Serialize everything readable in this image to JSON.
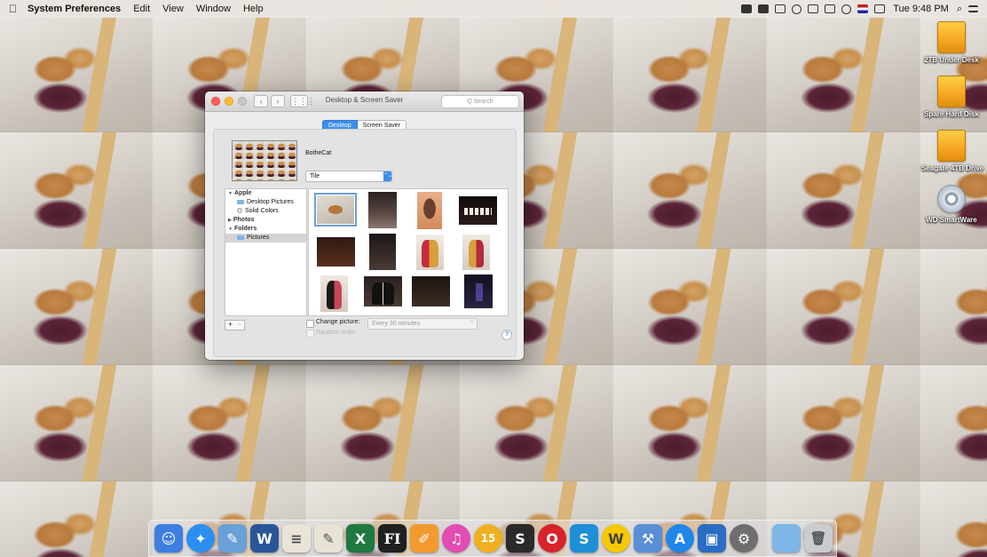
{
  "menubar": {
    "apple": "",
    "app_name": "System Preferences",
    "items": [
      "Edit",
      "View",
      "Window",
      "Help"
    ],
    "clock": "Tue 9:48 PM",
    "search_glyph": "⌕",
    "status_icons": [
      "dropbox-icon",
      "camera-icon",
      "airplay-icon",
      "time-machine-icon",
      "bluetooth-icon",
      "volume-icon",
      "wifi-icon",
      "flag-icon",
      "eject-icon",
      "spotlight-icon",
      "notification-center-icon"
    ]
  },
  "desktop": {
    "drives": [
      {
        "label": "2TB Under Desk",
        "icon": "external-drive-icon"
      },
      {
        "label": "Spare Hard Disk",
        "icon": "external-drive-icon"
      },
      {
        "label": "Seagate 4TB Drive",
        "icon": "external-drive-icon"
      },
      {
        "label": "WD SmartWare",
        "icon": "disc-icon"
      }
    ]
  },
  "window": {
    "title": "Desktop & Screen Saver",
    "search_placeholder": "Q Search",
    "nav_back": "‹",
    "nav_forward": "›",
    "grid_glyph": "⋮⋮⋮",
    "tabs": [
      "Desktop",
      "Screen Saver"
    ],
    "wallpaper_name": "BotheCat",
    "fit_option": "Tile",
    "select_arrow": "⌃⌄",
    "sources": [
      {
        "label": "Apple",
        "type": "group",
        "expand": "▼"
      },
      {
        "label": "Desktop Pictures",
        "type": "child"
      },
      {
        "label": "Solid Colors",
        "type": "child"
      },
      {
        "label": "Photos",
        "type": "group",
        "expand": "▶"
      },
      {
        "label": "Folders",
        "type": "group",
        "expand": "▼"
      },
      {
        "label": "Pictures",
        "type": "child",
        "selected": true
      }
    ],
    "add_label": "+",
    "remove_label": "−",
    "change_picture_label": "Change picture:",
    "interval_value": "Every 30 minutes",
    "interval_arrow": "⌃",
    "random_order_label": "Random order",
    "help_label": "?"
  },
  "dock": {
    "apps": [
      {
        "name": "finder",
        "glyph": "☺",
        "color": "#3d7fe0"
      },
      {
        "name": "safari",
        "glyph": "✦",
        "color": "#2a8ff0"
      },
      {
        "name": "preview",
        "glyph": "✎",
        "color": "#6aa0d8"
      },
      {
        "name": "word",
        "glyph": "W",
        "color": "#2a5699"
      },
      {
        "name": "notes",
        "glyph": "≡",
        "color": "#e9e4d6"
      },
      {
        "name": "textedit",
        "glyph": "✎",
        "color": "#e8e3d5"
      },
      {
        "name": "excel",
        "glyph": "X",
        "color": "#1f7a3f"
      },
      {
        "name": "fi-app",
        "glyph": "FI",
        "color": "#1f1f1f"
      },
      {
        "name": "pages",
        "glyph": "✐",
        "color": "#f29a2e"
      },
      {
        "name": "itunes",
        "glyph": "♫",
        "color": "#e34cb0"
      },
      {
        "name": "calendar-app",
        "glyph": "15",
        "color": "#f0b020"
      },
      {
        "name": "skype",
        "glyph": "S",
        "color": "#2a2a2a"
      },
      {
        "name": "opera",
        "glyph": "O",
        "color": "#d9222b"
      },
      {
        "name": "s-app",
        "glyph": "S",
        "color": "#1e8fd6"
      },
      {
        "name": "webex",
        "glyph": "W",
        "color": "#f5c800"
      },
      {
        "name": "xcode",
        "glyph": "⚒",
        "color": "#5a8fd6"
      },
      {
        "name": "app-store",
        "glyph": "A",
        "color": "#1f86ea"
      },
      {
        "name": "image-app",
        "glyph": "▣",
        "color": "#2b6cc4"
      },
      {
        "name": "system-preferences",
        "glyph": "⚙",
        "color": "#6e6e6e"
      },
      {
        "name": "folder",
        "glyph": "",
        "color": "#7fb6e8"
      },
      {
        "name": "trash",
        "glyph": "🗑",
        "color": "#c9ccd0"
      }
    ]
  }
}
